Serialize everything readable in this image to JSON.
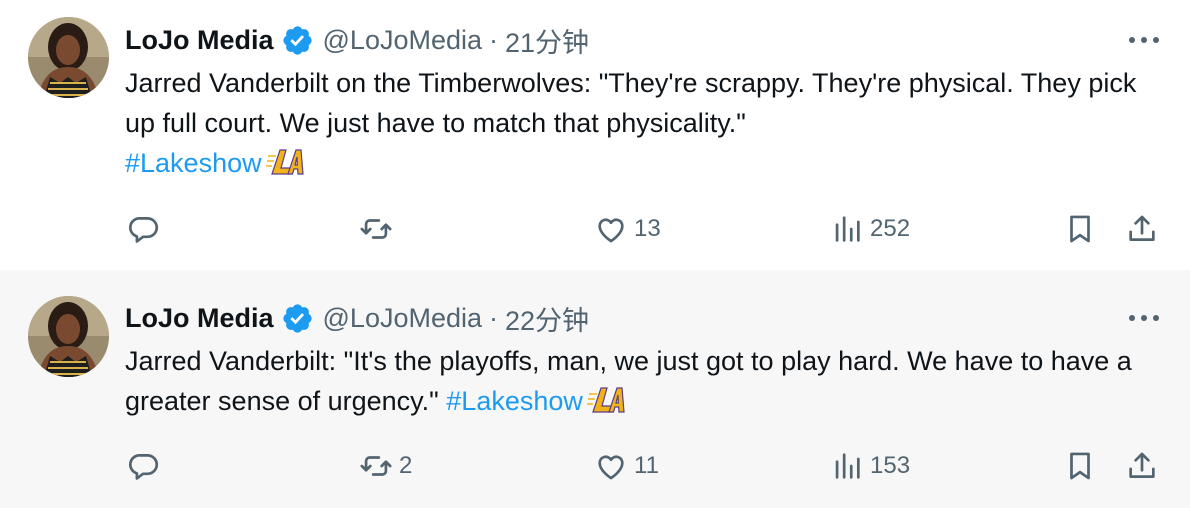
{
  "colors": {
    "text": "#0f1419",
    "muted": "#536471",
    "link": "#1d9bf0",
    "verified": "#1d9bf0",
    "alt_row_bg": "#f7f7f7"
  },
  "icons": [
    "verified-badge-icon",
    "more-icon",
    "reply-icon",
    "retweet-icon",
    "like-icon",
    "views-icon",
    "bookmark-icon",
    "share-icon",
    "lakers-logo-icon"
  ],
  "tweets": [
    {
      "author_name": "LoJo Media",
      "handle": "@LoJoMedia",
      "separator": "·",
      "time": "21分钟",
      "text": "Jarred Vanderbilt on the Timberwolves: \"They're scrappy. They're physical. They pick up full court. We just have to match that physicality.\"",
      "hashtag": "#Lakeshow",
      "replies": "",
      "retweets": "",
      "likes": "13",
      "views": "252"
    },
    {
      "author_name": "LoJo Media",
      "handle": "@LoJoMedia",
      "separator": "·",
      "time": "22分钟",
      "text": "Jarred Vanderbilt: \"It's the playoffs, man, we just got to play hard. We have to have a greater sense of urgency.\"",
      "hashtag": "#Lakeshow",
      "replies": "",
      "retweets": "2",
      "likes": "11",
      "views": "153"
    }
  ]
}
